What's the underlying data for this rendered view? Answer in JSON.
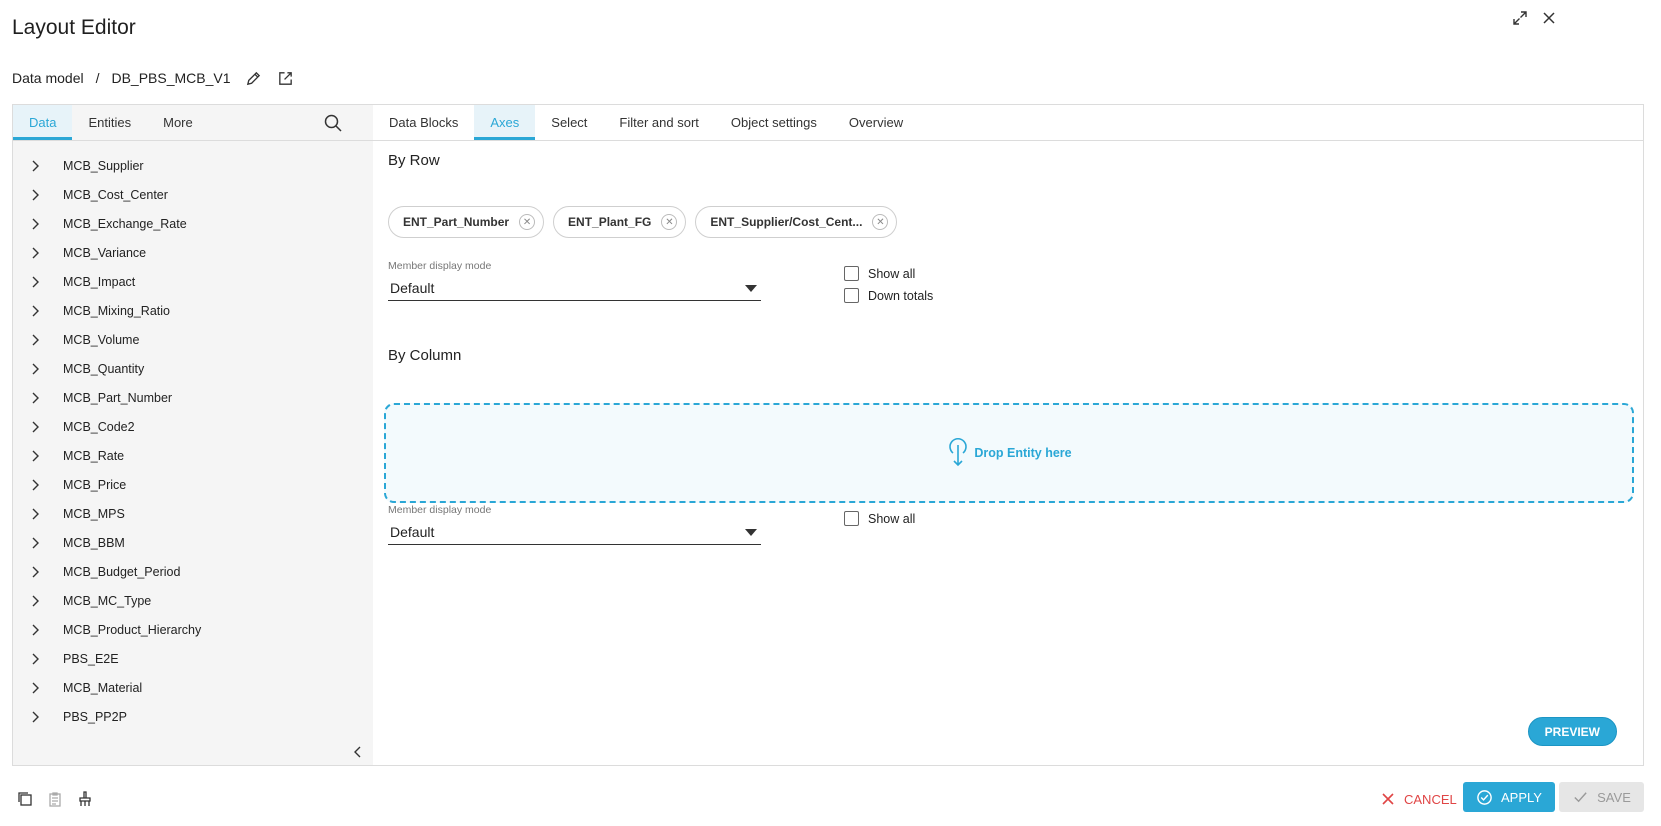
{
  "window": {
    "title": "Layout Editor"
  },
  "breadcrumb": {
    "root": "Data model",
    "separator": "/",
    "current": "DB_PBS_MCB_V1"
  },
  "left_tabs": [
    {
      "label": "Data",
      "active": true
    },
    {
      "label": "Entities",
      "active": false
    },
    {
      "label": "More",
      "active": false
    }
  ],
  "tree_items": [
    "MCB_Supplier",
    "MCB_Cost_Center",
    "MCB_Exchange_Rate",
    "MCB_Variance",
    "MCB_Impact",
    "MCB_Mixing_Ratio",
    "MCB_Volume",
    "MCB_Quantity",
    "MCB_Part_Number",
    "MCB_Code2",
    "MCB_Rate",
    "MCB_Price",
    "MCB_MPS",
    "MCB_BBM",
    "MCB_Budget_Period",
    "MCB_MC_Type",
    "MCB_Product_Hierarchy",
    "PBS_E2E",
    "MCB_Material",
    "PBS_PP2P"
  ],
  "right_tabs": [
    {
      "label": "Data Blocks",
      "active": false
    },
    {
      "label": "Axes",
      "active": true
    },
    {
      "label": "Select",
      "active": false
    },
    {
      "label": "Filter and sort",
      "active": false
    },
    {
      "label": "Object settings",
      "active": false
    },
    {
      "label": "Overview",
      "active": false
    }
  ],
  "by_row": {
    "title": "By Row",
    "chips": [
      "ENT_Part_Number",
      "ENT_Plant_FG",
      "ENT_Supplier/Cost_Cent..."
    ],
    "member_display_label": "Member display mode",
    "member_display_value": "Default",
    "show_all_label": "Show all",
    "down_totals_label": "Down totals"
  },
  "by_column": {
    "title": "By Column",
    "drop_text": "Drop Entity here",
    "member_display_label": "Member display mode",
    "member_display_value": "Default",
    "show_all_label": "Show all"
  },
  "buttons": {
    "preview": "PREVIEW",
    "cancel": "CANCEL",
    "apply": "APPLY",
    "save": "SAVE"
  },
  "colors": {
    "accent": "#2aa7d6",
    "cancel": "#e04545",
    "disabled": "#e6e6e6"
  }
}
